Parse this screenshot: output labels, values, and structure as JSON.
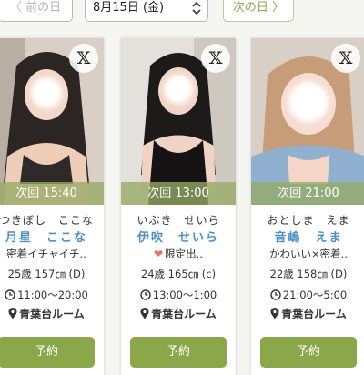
{
  "nav": {
    "prev_label": "前の日",
    "date_value": "8月15日 (金)",
    "next_label": "次の日"
  },
  "cards": [
    {
      "next_label": "次回 15:40",
      "kana": "つきぼし　ここな",
      "name": "月星　ここな",
      "catch": "密着イチャイチ..",
      "stats": "25歳 157㎝ (D)",
      "hours": "11:00〜20:00",
      "room": "青葉台ルーム",
      "reserve_label": "予約",
      "x_label": "𝕏"
    },
    {
      "next_label": "次回 13:00",
      "kana": "いぶき　せいら",
      "name": "伊吹　せいら",
      "catch": "限定出..",
      "stats": "24歳 165㎝ (c)",
      "hours": "13:00〜1:00",
      "room": "青葉台ルーム",
      "reserve_label": "予約",
      "x_label": "𝕏"
    },
    {
      "next_label": "次回 21:00",
      "kana": "おとしま　えま",
      "name": "音嶋　えま",
      "catch": "かわいい×密着..",
      "stats": "22歳 158㎝ (D)",
      "hours": "21:00〜5:00",
      "room": "青葉台ルーム",
      "reserve_label": "予約",
      "x_label": "𝕏"
    }
  ],
  "colors": {
    "accent": "#8aa84a",
    "name_blue": "#4a8fc7"
  }
}
